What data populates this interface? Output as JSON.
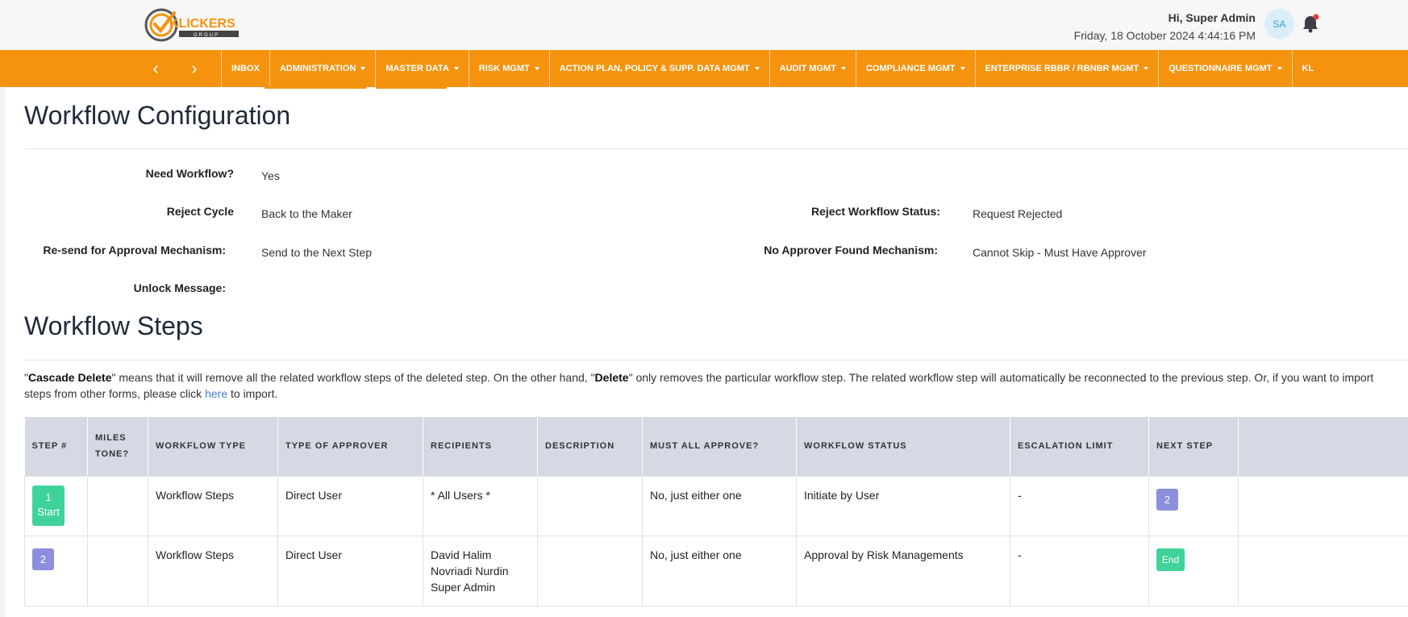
{
  "header": {
    "logo_text": "KLICKERS",
    "logo_sub": "GROUP",
    "greeting": "Hi, Super Admin",
    "datetime": "Friday, 18 October 2024 4:44:16 PM",
    "avatar_initials": "SA",
    "notification_dot_color": "#e53935"
  },
  "nav": {
    "prev_arrow": "‹",
    "next_arrow": "›",
    "items": [
      {
        "label": "INBOX",
        "dropdown": false
      },
      {
        "label": "ADMINISTRATION",
        "dropdown": true
      },
      {
        "label": "MASTER DATA",
        "dropdown": true
      },
      {
        "label": "RISK MGMT",
        "dropdown": true
      },
      {
        "label": "ACTION PLAN, POLICY & SUPP. DATA MGMT",
        "dropdown": true
      },
      {
        "label": "AUDIT MGMT",
        "dropdown": true
      },
      {
        "label": "COMPLIANCE MGMT",
        "dropdown": true
      },
      {
        "label": "ENTERPRISE RBBR / RBNBR MGMT",
        "dropdown": true
      },
      {
        "label": "QUESTIONNAIRE MGMT",
        "dropdown": true
      },
      {
        "label": "KL",
        "dropdown": false
      }
    ],
    "accent_color": "#f5930f"
  },
  "config": {
    "title": "Workflow Configuration",
    "need_workflow_label": "Need Workflow?",
    "need_workflow_value": "Yes",
    "reject_cycle_label": "Reject Cycle",
    "reject_cycle_value": "Back to the Maker",
    "reject_status_label": "Reject Workflow Status:",
    "reject_status_value": "Request Rejected",
    "resend_label": "Re-send for Approval Mechanism:",
    "resend_value": "Send to the Next Step",
    "no_approver_label": "No Approver Found Mechanism:",
    "no_approver_value": "Cannot Skip - Must Have Approver",
    "unlock_label": "Unlock Message:",
    "unlock_value": ""
  },
  "steps": {
    "title": "Workflow Steps",
    "note_part1": "\"",
    "note_cascade": "Cascade Delete",
    "note_part2": "\" means that it will remove all the related workflow steps of the deleted step. On the other hand, \"",
    "note_delete": "Delete",
    "note_part3": "\" only removes the particular workflow step. The related workflow step will automatically be reconnected to the previous step. Or, if you want to import steps from other forms, please click ",
    "note_link": "here",
    "note_part4": " to import.",
    "columns": {
      "step": "STEP #",
      "milestone_1": "MILES",
      "milestone_2": "TONE?",
      "workflow_type": "WORKFLOW TYPE",
      "approver_type": "TYPE OF APPROVER",
      "recipients": "RECIPIENTS",
      "description": "DESCRIPTION",
      "must_all": "MUST ALL APPROVE?",
      "status": "WORKFLOW STATUS",
      "escalation": "ESCALATION LIMIT",
      "next_step": "NEXT STEP"
    },
    "rows": [
      {
        "step_number": "1",
        "step_tag": "Start",
        "milestone": "",
        "workflow_type": "Workflow Steps",
        "approver_type": "Direct User",
        "recipients": [
          "* All Users *"
        ],
        "description": "",
        "must_all": "No, just either one",
        "status": "Initiate by User",
        "escalation": "-",
        "next_step": "2"
      },
      {
        "step_number": "2",
        "step_tag": "",
        "milestone": "",
        "workflow_type": "Workflow Steps",
        "approver_type": "Direct User",
        "recipients": [
          "David Halim",
          "Novriadi Nurdin",
          "Super Admin"
        ],
        "description": "",
        "must_all": "No, just either one",
        "status": "Approval by Risk Managements",
        "escalation": "-",
        "next_step": "End"
      }
    ]
  }
}
